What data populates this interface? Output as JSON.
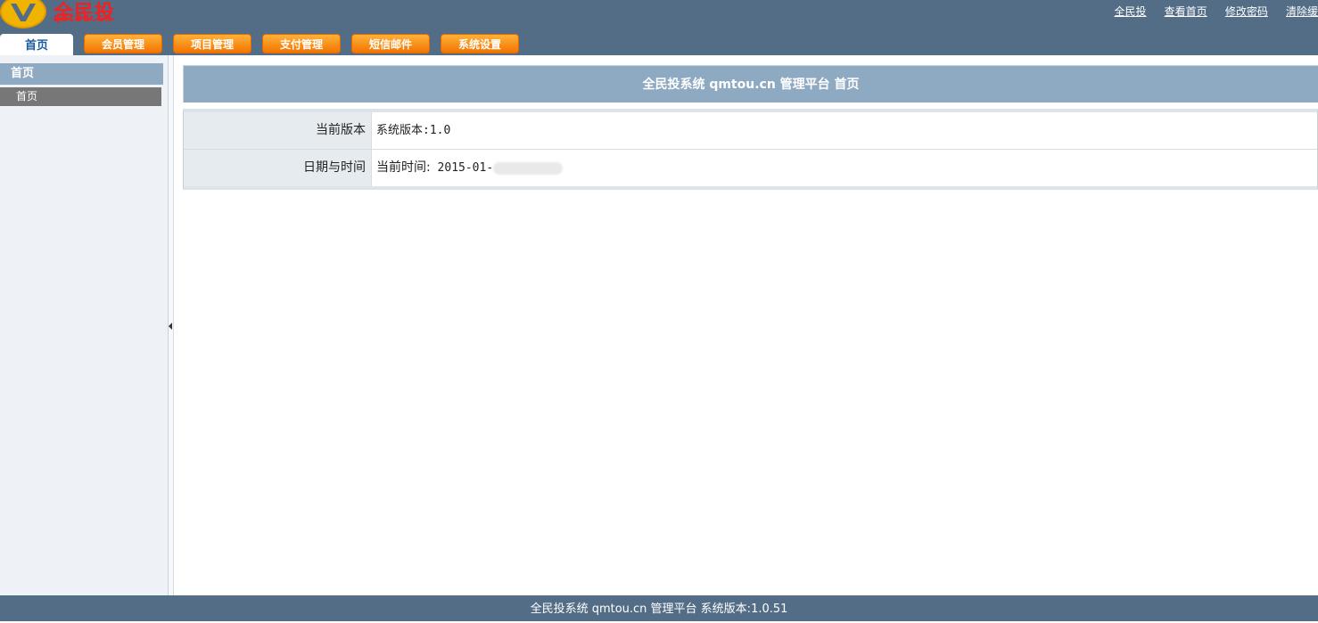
{
  "header": {
    "logo_name": "全民投",
    "logo_domain": "qmtou.cn",
    "links": [
      "全民投",
      "查看首页",
      "修改密码",
      "清除缓"
    ]
  },
  "nav": {
    "home": "首页",
    "tabs": [
      "会员管理",
      "项目管理",
      "支付管理",
      "短信邮件",
      "系统设置"
    ]
  },
  "sidebar": {
    "section_title": "首页",
    "items": [
      "首页"
    ]
  },
  "main": {
    "title": "全民投系统 qmtou.cn 管理平台 首页",
    "rows": [
      {
        "label": "当前版本",
        "value": "系统版本:1.0"
      },
      {
        "label": "日期与时间",
        "value_prefix": "当前时间:",
        "value": "2015-01-"
      }
    ]
  },
  "footer": {
    "text": "全民投系统 qmtou.cn 管理平台 系统版本:1.0.51"
  }
}
